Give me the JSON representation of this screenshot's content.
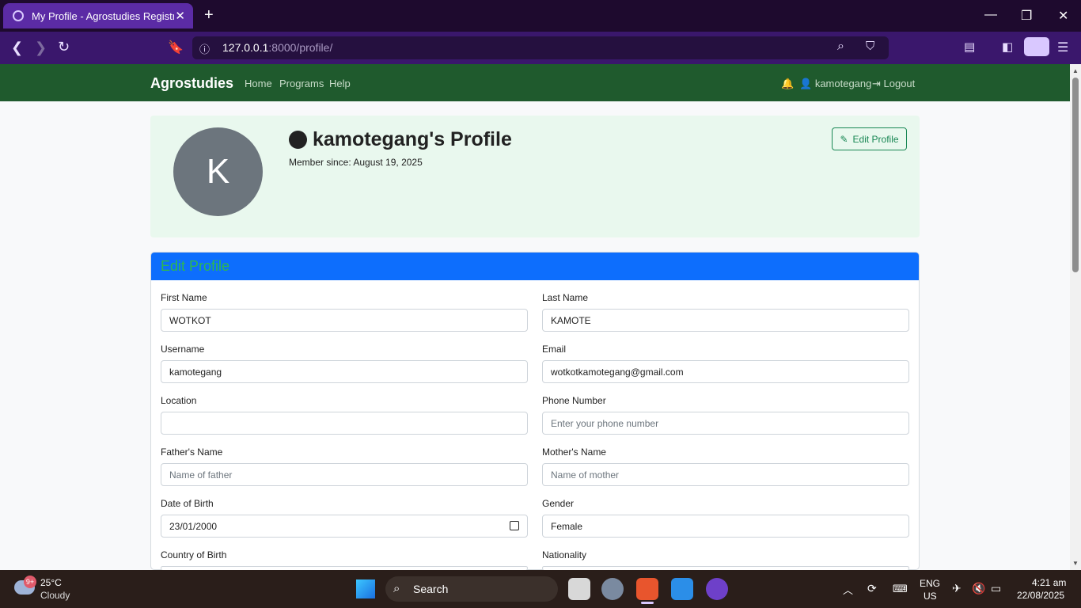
{
  "browser": {
    "tab_title": "My Profile - Agrostudies Registra",
    "url_host": "127.0.0.1",
    "url_path": ":8000/profile/"
  },
  "site": {
    "brand": "Agrostudies",
    "nav": [
      "Home",
      "Programs",
      "Help"
    ],
    "username": "kamotegang",
    "logout": "Logout"
  },
  "profile": {
    "avatar_letter": "K",
    "title": "kamotegang's Profile",
    "member_since": "Member since: August 19, 2025",
    "edit_button": "Edit Profile"
  },
  "form": {
    "title": "Edit Profile",
    "fields": [
      {
        "label": "First Name",
        "value": "WOTKOT",
        "placeholder": ""
      },
      {
        "label": "Last Name",
        "value": "KAMOTE",
        "placeholder": ""
      },
      {
        "label": "Username",
        "value": "kamotegang",
        "placeholder": ""
      },
      {
        "label": "Email",
        "value": "wotkotkamotegang@gmail.com",
        "placeholder": ""
      },
      {
        "label": "Location",
        "value": "",
        "placeholder": ""
      },
      {
        "label": "Phone Number",
        "value": "",
        "placeholder": "Enter your phone number"
      },
      {
        "label": "Father's Name",
        "value": "",
        "placeholder": "Name of father"
      },
      {
        "label": "Mother's Name",
        "value": "",
        "placeholder": "Name of mother"
      },
      {
        "label": "Date of Birth",
        "value": "23/01/2000",
        "placeholder": ""
      },
      {
        "label": "Gender",
        "value": "Female",
        "placeholder": ""
      },
      {
        "label": "Country of Birth",
        "value": "",
        "placeholder": ""
      },
      {
        "label": "Nationality",
        "value": "",
        "placeholder": ""
      }
    ]
  },
  "taskbar": {
    "weather_badge": "9+",
    "temperature": "25°C",
    "condition": "Cloudy",
    "search_label": "Search",
    "lang1": "ENG",
    "lang2": "US",
    "time": "4:21 am",
    "date": "22/08/2025"
  },
  "colors": {
    "site_nav": "#1f5a2d",
    "form_header": "#0d6efd",
    "accent_green": "#198754"
  }
}
